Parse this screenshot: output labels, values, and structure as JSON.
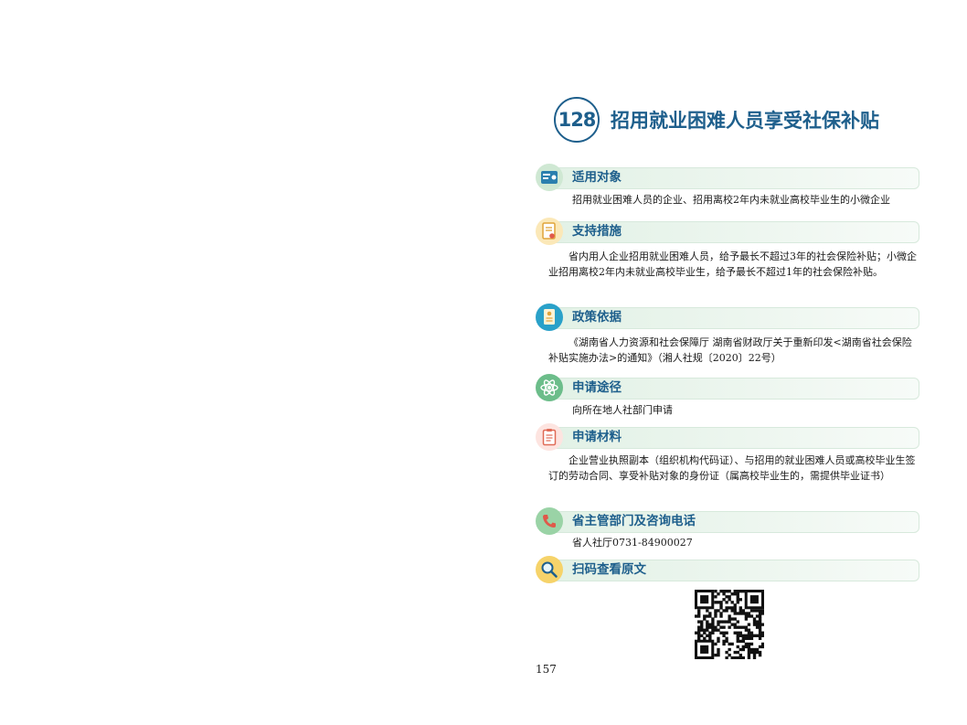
{
  "header": {
    "number": "128",
    "title": "招用就业困难人员享受社保补贴"
  },
  "sections": [
    {
      "title": "适用对象",
      "icon": "id-card-icon",
      "body": "招用就业困难人员的企业、招用离校2年内未就业高校毕业生的小微企业"
    },
    {
      "title": "支持措施",
      "icon": "certificate-icon",
      "body": "省内用人企业招用就业困难人员，给予最长不超过3年的社会保险补贴；小微企业招用离校2年内未就业高校毕业生，给予最长不超过1年的社会保险补贴。"
    },
    {
      "title": "政策依据",
      "icon": "document-icon",
      "body": "《湖南省人力资源和社会保障厅 湖南省财政厅关于重新印发<湖南省社会保险补贴实施办法>的通知》（湘人社规〔2020〕22号）"
    },
    {
      "title": "申请途径",
      "icon": "atom-icon",
      "body": "向所在地人社部门申请"
    },
    {
      "title": "申请材料",
      "icon": "clipboard-icon",
      "body": "企业营业执照副本（组织机构代码证）、与招用的就业困难人员或高校毕业生签订的劳动合同、享受补贴对象的身份证（属高校毕业生的，需提供毕业证书）"
    },
    {
      "title": "省主管部门及咨询电话",
      "icon": "phone-icon",
      "body": "省人社厅0731-84900027"
    },
    {
      "title": "扫码查看原文",
      "icon": "magnifier-icon",
      "body": ""
    }
  ],
  "colors": {
    "accent": "#1e5f8c",
    "bar": "#e2f1e6"
  },
  "page_number": "157"
}
